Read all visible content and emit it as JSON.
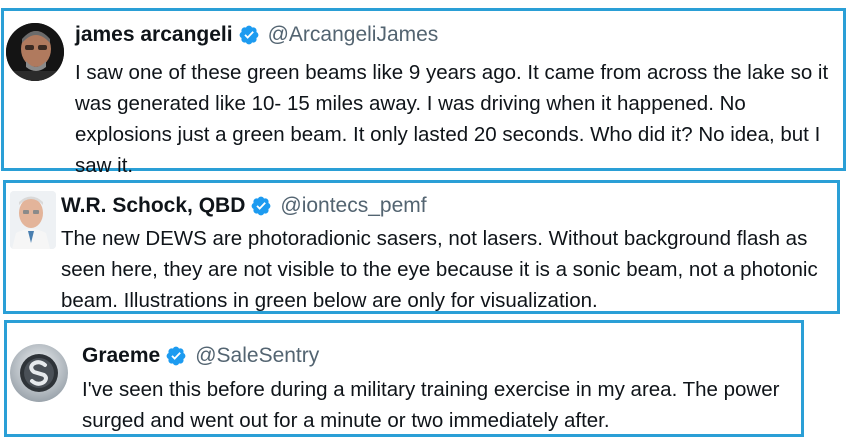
{
  "tweets": [
    {
      "name": "james arcangeli",
      "handle": "@ArcangeliJames",
      "verified": true,
      "text": "I saw one of these green beams like 9 years ago. It came from across the lake so it was generated like 10- 15 miles away. I was driving when it happened. No explosions just a green beam. It only lasted 20 seconds. Who did it? No idea, but I saw it."
    },
    {
      "name": "W.R. Schock, QBD",
      "handle": "@iontecs_pemf",
      "verified": true,
      "text": "The new DEWS are photoradionic sasers, not lasers. Without background flash as seen here, they are not visible to the eye because it is a sonic beam, not a photonic beam. Illustrations in green below are only for visualization."
    },
    {
      "name": "Graeme",
      "handle": "@SaleSentry",
      "verified": true,
      "text": "I've seen this before during a military training exercise in my area. The power surged and went out for a minute or two immediately after."
    }
  ],
  "colors": {
    "highlight_border": "#2a9fd6",
    "verified_badge": "#1d9bf0",
    "handle_text": "#536471"
  }
}
